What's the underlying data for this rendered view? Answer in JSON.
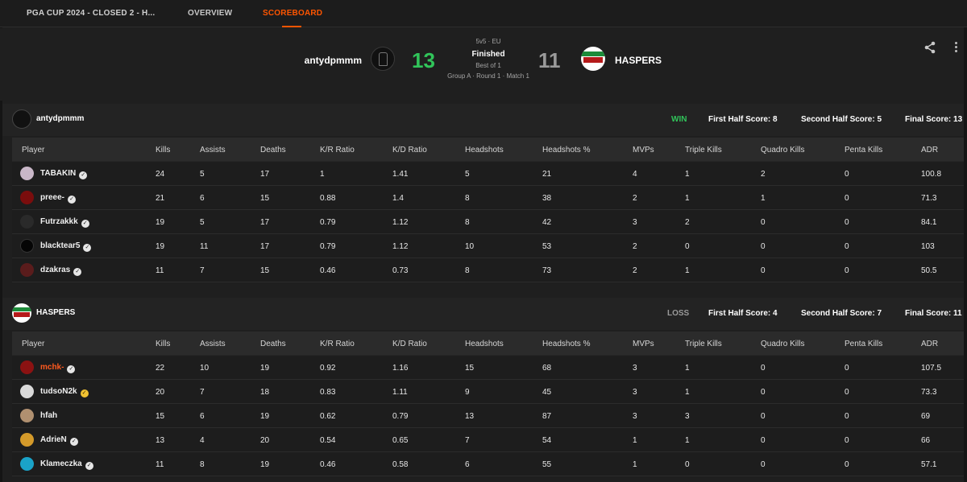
{
  "tabs": [
    {
      "label": "PGA CUP 2024 - CLOSED 2 - H..."
    },
    {
      "label": "OVERVIEW"
    },
    {
      "label": "SCOREBOARD"
    }
  ],
  "match": {
    "format": "5v5 · EU",
    "status": "Finished",
    "best_of": "Best of 1",
    "round_info": "Group A · Round 1 · Match 1",
    "team1": {
      "name": "antydpmmm",
      "score": "13"
    },
    "team2": {
      "name": "HASPERS",
      "score": "11"
    }
  },
  "colors": {
    "accent": "#ff5500",
    "win": "#31c45a",
    "loss": "#9a9a9a",
    "header_bg": "#2b2b2b"
  },
  "icons": {
    "share": "share-icon",
    "more": "more-vertical-icon",
    "verified": "verified-check-icon"
  },
  "columns": [
    "Player",
    "Kills",
    "Assists",
    "Deaths",
    "K/R Ratio",
    "K/D Ratio",
    "Headshots",
    "Headshots %",
    "MVPs",
    "Triple Kills",
    "Quadro Kills",
    "Penta Kills",
    "ADR"
  ],
  "teams": [
    {
      "name": "antydpmmm",
      "result": "WIN",
      "first_half": "First Half Score: 8",
      "second_half": "Second Half Score: 5",
      "final": "Final Score: 13",
      "players": [
        {
          "name": "TABAKIN",
          "stats": [
            "24",
            "5",
            "17",
            "1",
            "1.41",
            "5",
            "21",
            "4",
            "1",
            "2",
            "0",
            "100.8"
          ]
        },
        {
          "name": "preee-",
          "stats": [
            "21",
            "6",
            "15",
            "0.88",
            "1.4",
            "8",
            "38",
            "2",
            "1",
            "1",
            "0",
            "71.3"
          ]
        },
        {
          "name": "Futrzakkk",
          "stats": [
            "19",
            "5",
            "17",
            "0.79",
            "1.12",
            "8",
            "42",
            "3",
            "2",
            "0",
            "0",
            "84.1"
          ]
        },
        {
          "name": "blacktear5",
          "stats": [
            "19",
            "11",
            "17",
            "0.79",
            "1.12",
            "10",
            "53",
            "2",
            "0",
            "0",
            "0",
            "103"
          ]
        },
        {
          "name": "dzakras",
          "stats": [
            "11",
            "7",
            "15",
            "0.46",
            "0.73",
            "8",
            "73",
            "2",
            "1",
            "0",
            "0",
            "50.5"
          ]
        }
      ]
    },
    {
      "name": "HASPERS",
      "result": "LOSS",
      "first_half": "First Half Score: 4",
      "second_half": "Second Half Score: 7",
      "final": "Final Score: 11",
      "players": [
        {
          "name": "mchk-",
          "stats": [
            "22",
            "10",
            "19",
            "0.92",
            "1.16",
            "15",
            "68",
            "3",
            "1",
            "0",
            "0",
            "107.5"
          ]
        },
        {
          "name": "tudsoN2k",
          "stats": [
            "20",
            "7",
            "18",
            "0.83",
            "1.11",
            "9",
            "45",
            "3",
            "1",
            "0",
            "0",
            "73.3"
          ]
        },
        {
          "name": "hfah",
          "stats": [
            "15",
            "6",
            "19",
            "0.62",
            "0.79",
            "13",
            "87",
            "3",
            "3",
            "0",
            "0",
            "69"
          ]
        },
        {
          "name": "AdrieN",
          "stats": [
            "13",
            "4",
            "20",
            "0.54",
            "0.65",
            "7",
            "54",
            "1",
            "1",
            "0",
            "0",
            "66"
          ]
        },
        {
          "name": "Klameczka",
          "stats": [
            "11",
            "8",
            "19",
            "0.46",
            "0.58",
            "6",
            "55",
            "1",
            "0",
            "0",
            "0",
            "57.1"
          ]
        }
      ]
    }
  ]
}
